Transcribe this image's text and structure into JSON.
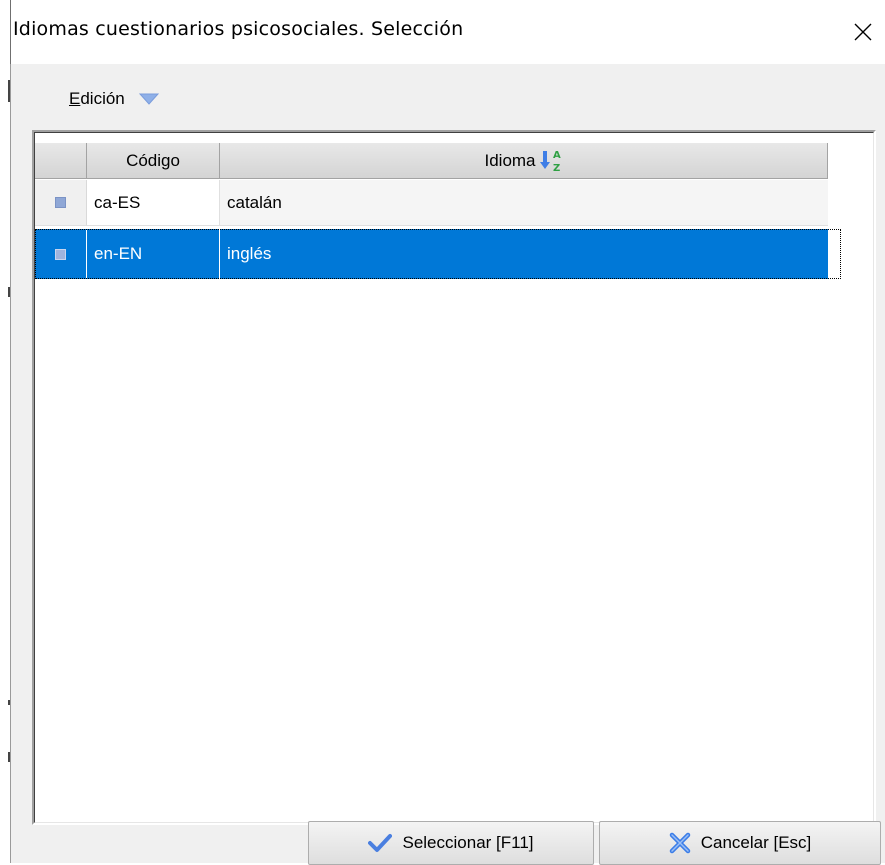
{
  "window": {
    "title": "Idiomas cuestionarios psicosociales. Selección"
  },
  "menu": {
    "edicion_prefix": "E",
    "edicion_rest": "dición"
  },
  "grid": {
    "columns": [
      "",
      "Código",
      "Idioma"
    ],
    "sort_column": "Idioma",
    "rows": [
      {
        "code": "ca-ES",
        "language": "catalán",
        "selected": false
      },
      {
        "code": "en-EN",
        "language": "inglés",
        "selected": true
      }
    ]
  },
  "buttons": {
    "select_label": "Seleccionar [F11]",
    "cancel_label": "Cancelar [Esc]"
  },
  "colors": {
    "selection": "#0078d7",
    "indicator": "#8fa7d6",
    "check": "#4a7fe0",
    "cancel_x": "#3b7de8"
  },
  "icons": {
    "close": "close-icon",
    "dropdown": "chevron-down-icon",
    "sort": "sort-ascending-az-icon",
    "select": "checkmark-icon",
    "cancel": "cancel-x-icon"
  }
}
